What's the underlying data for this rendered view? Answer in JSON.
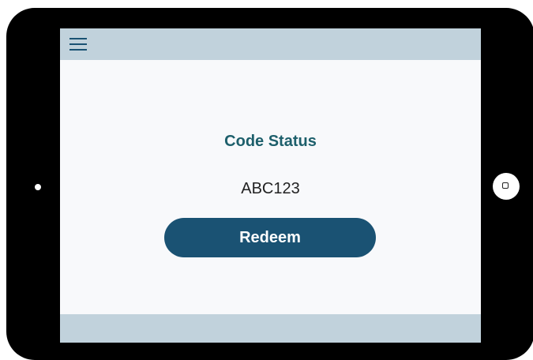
{
  "header": {
    "menu_icon": "hamburger-menu-icon"
  },
  "main": {
    "title": "Code Status",
    "code": "ABC123",
    "redeem_label": "Redeem"
  },
  "colors": {
    "bar_background": "#c1d2dc",
    "screen_background": "#f8f9fb",
    "title_color": "#1d5f6b",
    "button_color": "#1a5273",
    "device_frame": "#000000"
  }
}
